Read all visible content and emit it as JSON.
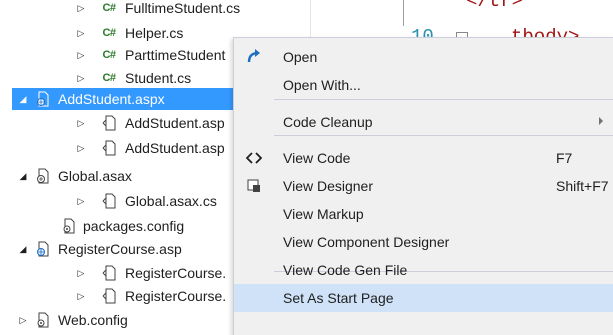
{
  "tree": {
    "items": [
      {
        "label": "FulltimeStudent.cs",
        "icon": "csharp-file-icon",
        "icon_text": "C#",
        "expander": "collapsed"
      },
      {
        "label": "Helper.cs",
        "icon": "csharp-file-icon",
        "icon_text": "C#",
        "expander": "collapsed"
      },
      {
        "label": "ParttimeStudent",
        "icon": "csharp-file-icon",
        "icon_text": "C#",
        "expander": "collapsed"
      },
      {
        "label": "Student.cs",
        "icon": "csharp-file-icon",
        "icon_text": "C#",
        "expander": "collapsed"
      },
      {
        "label": "AddStudent.aspx",
        "icon": "aspx-file-icon",
        "expander": "expanded",
        "selected": true
      },
      {
        "label": "AddStudent.asp",
        "icon": "code-file-icon",
        "expander": "collapsed"
      },
      {
        "label": "AddStudent.asp",
        "icon": "code-file-icon",
        "expander": "collapsed"
      },
      {
        "label": "Global.asax",
        "icon": "asax-file-icon",
        "expander": "expanded"
      },
      {
        "label": "Global.asax.cs",
        "icon": "code-file-icon",
        "expander": "collapsed"
      },
      {
        "label": "packages.config",
        "icon": "config-file-icon",
        "expander": "none"
      },
      {
        "label": "RegisterCourse.asp",
        "icon": "aspx-file-icon",
        "expander": "expanded"
      },
      {
        "label": "RegisterCourse.",
        "icon": "code-file-icon",
        "expander": "collapsed"
      },
      {
        "label": "RegisterCourse.",
        "icon": "code-file-icon",
        "expander": "collapsed"
      },
      {
        "label": "Web.config",
        "icon": "config-file-icon",
        "expander": "collapsed"
      }
    ]
  },
  "editor": {
    "line_number": "10",
    "code_top": "</tr>",
    "code_line": "tbody>"
  },
  "context_menu": {
    "items": [
      {
        "label": "Open",
        "icon": "open-arrow-icon",
        "shortcut": ""
      },
      {
        "label": "Open With...",
        "shortcut": ""
      },
      {
        "label": "Code Cleanup",
        "shortcut": "",
        "submenu": true
      },
      {
        "label": "View Code",
        "icon": "code-brackets-icon",
        "shortcut": "F7"
      },
      {
        "label": "View Designer",
        "icon": "designer-icon",
        "shortcut": "Shift+F7"
      },
      {
        "label": "View Markup",
        "shortcut": ""
      },
      {
        "label": "View Component Designer",
        "shortcut": ""
      },
      {
        "label": "View Code Gen File",
        "shortcut": ""
      },
      {
        "label": "Set As Start Page",
        "shortcut": "",
        "highlighted": true
      }
    ]
  },
  "colors": {
    "selection": "#3399ff",
    "menu_highlight": "#cfe2f7",
    "csharp_icon": "#2b7a2b",
    "open_icon": "#1e6fc2"
  }
}
